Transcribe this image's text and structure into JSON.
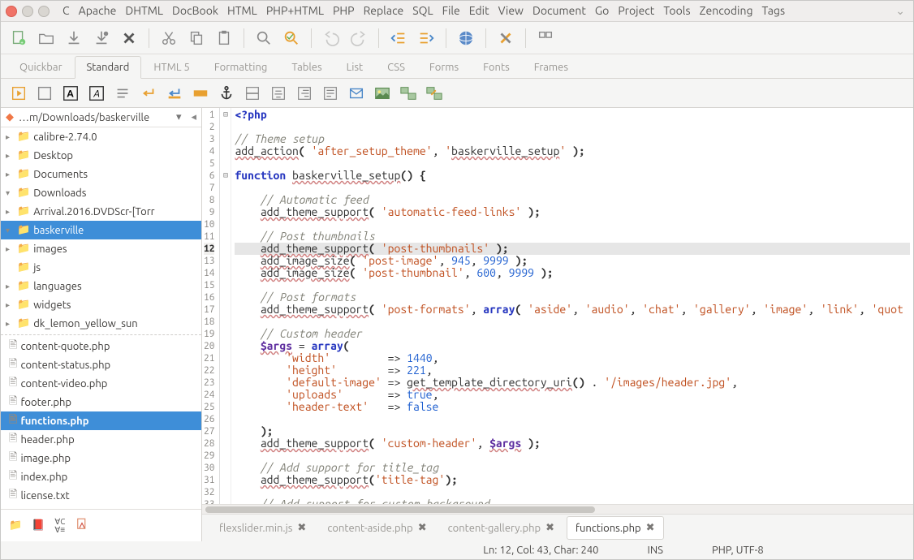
{
  "menubar": [
    "C",
    "Apache",
    "DHTML",
    "DocBook",
    "HTML",
    "PHP+HTML",
    "PHP",
    "Replace",
    "SQL",
    "File",
    "Edit",
    "View",
    "Document",
    "Go",
    "Project",
    "Tools",
    "Zencoding",
    "Tags"
  ],
  "notebook_tabs": [
    "Quickbar",
    "Standard",
    "HTML 5",
    "Formatting",
    "Tables",
    "List",
    "CSS",
    "Forms",
    "Fonts",
    "Frames"
  ],
  "notebook_active": "Standard",
  "sidebar": {
    "path": "…m/Downloads/baskerville",
    "tree": [
      {
        "depth": 1,
        "expander": "▸",
        "icon": "folder",
        "color": "fld-purple",
        "label": "calibre-2.74.0"
      },
      {
        "depth": 1,
        "expander": "▸",
        "icon": "folder",
        "color": "fld-purple",
        "label": "Desktop"
      },
      {
        "depth": 1,
        "expander": "▸",
        "icon": "folder",
        "color": "fld",
        "label": "Documents"
      },
      {
        "depth": 1,
        "expander": "▾",
        "icon": "folder",
        "color": "fld",
        "label": "Downloads"
      },
      {
        "depth": 2,
        "expander": "▸",
        "icon": "folder",
        "color": "fld",
        "label": "Arrival.2016.DVDScr-[Torr"
      },
      {
        "depth": 2,
        "expander": "▾",
        "icon": "folder",
        "color": "fld-red",
        "label": "baskerville",
        "selected": true
      },
      {
        "depth": 3,
        "expander": "▸",
        "icon": "folder",
        "color": "fld-red",
        "label": "images"
      },
      {
        "depth": 3,
        "expander": "",
        "icon": "folder",
        "color": "fld-red",
        "label": "js"
      },
      {
        "depth": 3,
        "expander": "▸",
        "icon": "folder",
        "color": "fld-red",
        "label": "languages"
      },
      {
        "depth": 3,
        "expander": "▸",
        "icon": "folder",
        "color": "fld-red",
        "label": "widgets"
      },
      {
        "depth": 2,
        "expander": "▸",
        "icon": "folder",
        "color": "fld",
        "label": "dk_lemon_yellow_sun"
      }
    ],
    "files": [
      "content-quote.php",
      "content-status.php",
      "content-video.php",
      "footer.php",
      "functions.php",
      "header.php",
      "image.php",
      "index.php",
      "license.txt"
    ],
    "selected_file": "functions.php"
  },
  "gutter_start": 1,
  "gutter_end": 33,
  "current_line": 12,
  "code_lines": [
    {
      "n": 1,
      "fold": "⊟",
      "html": "<span class='tok-php'>&lt;?php</span>"
    },
    {
      "n": 2,
      "html": ""
    },
    {
      "n": 3,
      "html": "<span class='tok-cmt'>// Theme setup</span>"
    },
    {
      "n": 4,
      "html": "<span class='tok-fn'>add_action</span><span class='tok-punc'>(</span> <span class='tok-str'>'after_setup_theme'</span>, <span class='tok-str'>'<span class='tok-fn2'>baskerville_setup</span>'</span> <span class='tok-punc'>);</span>"
    },
    {
      "n": 5,
      "html": ""
    },
    {
      "n": 6,
      "fold": "⊟",
      "html": "<span class='tok-kw'>function</span> <span class='tok-fn'>baskerville_setup</span><span class='tok-punc'>() {</span>"
    },
    {
      "n": 7,
      "html": ""
    },
    {
      "n": 8,
      "html": "    <span class='tok-cmt'>// Automatic feed</span>"
    },
    {
      "n": 9,
      "html": "    <span class='tok-fn'>add_theme_support</span><span class='tok-punc'>(</span> <span class='tok-str'>'automatic-feed-links'</span> <span class='tok-punc'>);</span>"
    },
    {
      "n": 10,
      "html": ""
    },
    {
      "n": 11,
      "html": "    <span class='tok-cmt'>// Post thumbnails</span>"
    },
    {
      "n": 12,
      "cur": true,
      "html": "    <span class='tok-fn'>add_theme_support</span><span class='tok-punc'>(</span> <span class='tok-str'>'post-thumbnails'</span> <span class='tok-punc'>);</span>"
    },
    {
      "n": 13,
      "html": "    <span class='tok-fn'>add_image_size</span><span class='tok-punc'>(</span> <span class='tok-str'>'post-image'</span>, <span class='tok-num'>945</span>, <span class='tok-num'>9999</span> <span class='tok-punc'>);</span>"
    },
    {
      "n": 14,
      "html": "    <span class='tok-fn'>add_image_size</span><span class='tok-punc'>(</span> <span class='tok-str'>'post-thumbnail'</span>, <span class='tok-num'>600</span>, <span class='tok-num'>9999</span> <span class='tok-punc'>);</span>"
    },
    {
      "n": 15,
      "html": ""
    },
    {
      "n": 16,
      "html": "    <span class='tok-cmt'>// Post formats</span>"
    },
    {
      "n": 17,
      "html": "    <span class='tok-fn'>add_theme_support</span><span class='tok-punc'>(</span> <span class='tok-str'>'post-formats'</span>, <span class='tok-kw'>array</span><span class='tok-punc'>(</span> <span class='tok-str'>'aside'</span>, <span class='tok-str'>'audio'</span>, <span class='tok-str'>'chat'</span>, <span class='tok-str'>'gallery'</span>, <span class='tok-str'>'image'</span>, <span class='tok-str'>'link'</span>, <span class='tok-str'>'quot</span>"
    },
    {
      "n": 18,
      "html": ""
    },
    {
      "n": 19,
      "html": "    <span class='tok-cmt'>// Custom header</span>"
    },
    {
      "n": 20,
      "html": "    <span class='tok-var'>$args</span> = <span class='tok-kw'>array</span><span class='tok-punc'>(</span>"
    },
    {
      "n": 21,
      "html": "        <span class='tok-str'>'width'</span>         =&gt; <span class='tok-num'>1440</span>,"
    },
    {
      "n": 22,
      "html": "        <span class='tok-str'>'height'</span>        =&gt; <span class='tok-num'>221</span>,"
    },
    {
      "n": 23,
      "html": "        <span class='tok-str'>'default-image'</span> =&gt; <span class='tok-fn'>get_template_directory_uri</span><span class='tok-punc'>()</span> . <span class='tok-str'>'/images/header.jpg'</span>,"
    },
    {
      "n": 24,
      "html": "        <span class='tok-str'>'uploads'</span>       =&gt; <span class='tok-bool'>true</span>,"
    },
    {
      "n": 25,
      "html": "        <span class='tok-str'>'header-text'</span>   =&gt; <span class='tok-bool'>false</span>"
    },
    {
      "n": 26,
      "html": ""
    },
    {
      "n": 27,
      "html": "    <span class='tok-punc'>);</span>"
    },
    {
      "n": 28,
      "html": "    <span class='tok-fn'>add_theme_support</span><span class='tok-punc'>(</span> <span class='tok-str'>'custom-header'</span>, <span class='tok-var'>$args</span> <span class='tok-punc'>);</span>"
    },
    {
      "n": 29,
      "html": ""
    },
    {
      "n": 30,
      "html": "    <span class='tok-cmt'>// Add support for title_tag</span>"
    },
    {
      "n": 31,
      "html": "    <span class='tok-fn'>add_theme_support</span><span class='tok-punc'>(</span><span class='tok-str'>'title-tag'</span><span class='tok-punc'>);</span>"
    },
    {
      "n": 32,
      "html": ""
    },
    {
      "n": 33,
      "html": "    <span class='tok-cmt'>// Add support for custom background</span>"
    }
  ],
  "file_tabs": [
    {
      "label": "flexslider.min.js",
      "close": true
    },
    {
      "label": "content-aside.php",
      "close": true
    },
    {
      "label": "content-gallery.php",
      "close": true
    },
    {
      "label": "functions.php",
      "close": true,
      "active": true
    }
  ],
  "status": {
    "pos": "Ln: 12, Col: 43, Char: 240",
    "ins": "INS",
    "mode": "PHP, UTF-8"
  }
}
